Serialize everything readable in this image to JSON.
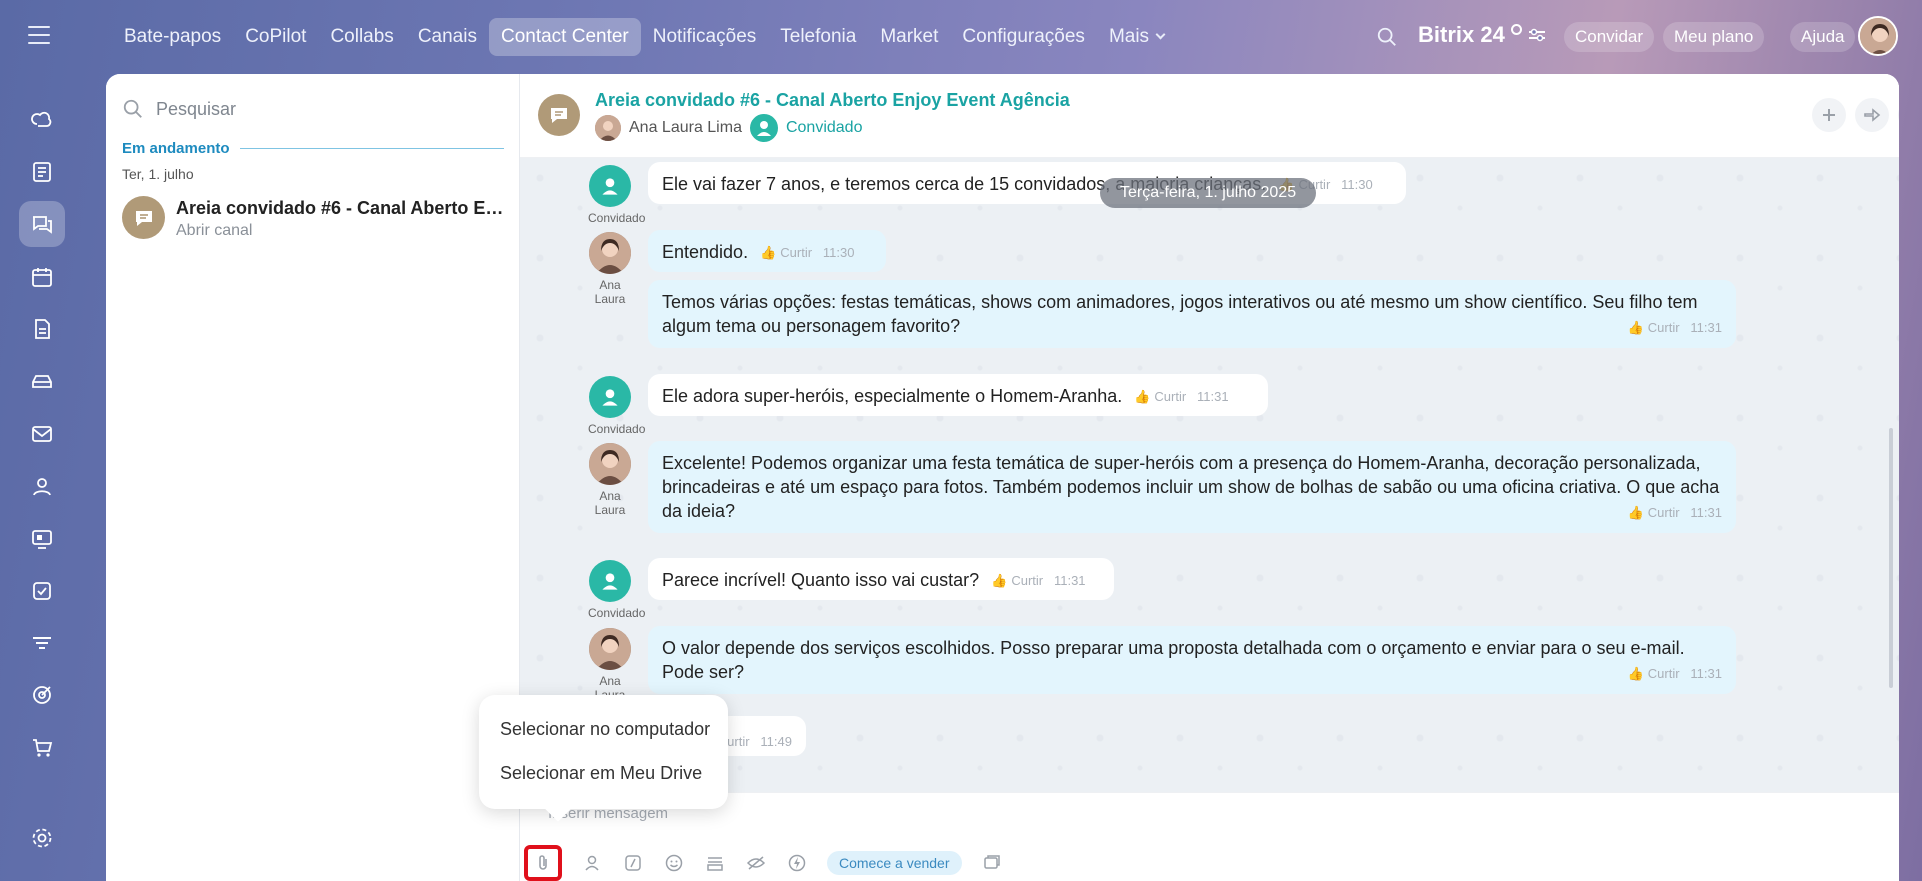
{
  "topnav": {
    "tabs": [
      {
        "label": "Bate-papos",
        "active": false
      },
      {
        "label": "CoPilot",
        "active": false
      },
      {
        "label": "Collabs",
        "active": false
      },
      {
        "label": "Canais",
        "active": false
      },
      {
        "label": "Contact Center",
        "active": true
      },
      {
        "label": "Notificações",
        "active": false
      },
      {
        "label": "Telefonia",
        "active": false
      },
      {
        "label": "Market",
        "active": false
      },
      {
        "label": "Configurações",
        "active": false
      },
      {
        "label": "Mais",
        "active": false
      }
    ],
    "brand": "Bitrix 24",
    "invite": "Convidar",
    "plan": "Meu plano",
    "help": "Ajuda"
  },
  "sidebar": {
    "icons": [
      "copilot-icon",
      "feed-icon",
      "chat-icon",
      "calendar-icon",
      "document-icon",
      "inbox-icon",
      "mail-icon",
      "contacts-icon",
      "sites-icon",
      "tasks-icon",
      "filter-icon",
      "target-icon",
      "cart-icon",
      "settings-icon"
    ],
    "active": "chat-icon"
  },
  "chatlist": {
    "search_placeholder": "Pesquisar",
    "section": "Em andamento",
    "date": "Ter, 1. julho",
    "item": {
      "title": "Areia convidado #6 - Canal Aberto Enj...",
      "subtitle": "Abrir canal"
    }
  },
  "header": {
    "title": "Areia convidado #6 - Canal Aberto Enjoy Event Agência",
    "agent": "Ana Laura Lima",
    "guest": "Convidado"
  },
  "chat": {
    "date_badge": "Terça-feira, 1. julho 2025",
    "like_label": "Curtir",
    "messages": [
      {
        "author": "Convidado",
        "text": "Ele vai fazer 7 anos, e teremos cerca de 15 convidados, a maioria crianças.",
        "time": "11:30"
      },
      {
        "author": "Ana Laura",
        "text": "Entendido.",
        "time": "11:30"
      },
      {
        "author": "",
        "text": "Temos várias opções: festas temáticas, shows com animadores, jogos interativos ou até mesmo um show científico. Seu filho tem algum tema ou personagem favorito?",
        "time": "11:31"
      },
      {
        "author": "Convidado",
        "text": "Ele adora super-heróis, especialmente o Homem-Aranha.",
        "time": "11:31"
      },
      {
        "author": "Ana Laura",
        "text": "Excelente! Podemos organizar uma festa temática de super-heróis com a presença do Homem-Aranha, decoração personalizada, brincadeiras e até um espaço para fotos. Também podemos incluir um show de bolhas de sabão ou uma oficina criativa. O que acha da ideia?",
        "time": "11:31"
      },
      {
        "author": "Convidado",
        "text": "Parece incrível! Quanto isso vai custar?",
        "time": "11:31"
      },
      {
        "author": "Ana Laura",
        "text": "O valor depende dos serviços escolhidos. Posso preparar uma proposta detalhada com o orçamento e enviar para o seu e-mail. Pode ser?",
        "time": "11:31"
      },
      {
        "author": "",
        "text": "",
        "time": "11:49"
      }
    ]
  },
  "composer": {
    "placeholder": "Inserir mensagem",
    "sell_label": "Comece a vender"
  },
  "attach_menu": {
    "items": [
      "Selecionar no computador",
      "Selecionar em Meu Drive"
    ]
  }
}
